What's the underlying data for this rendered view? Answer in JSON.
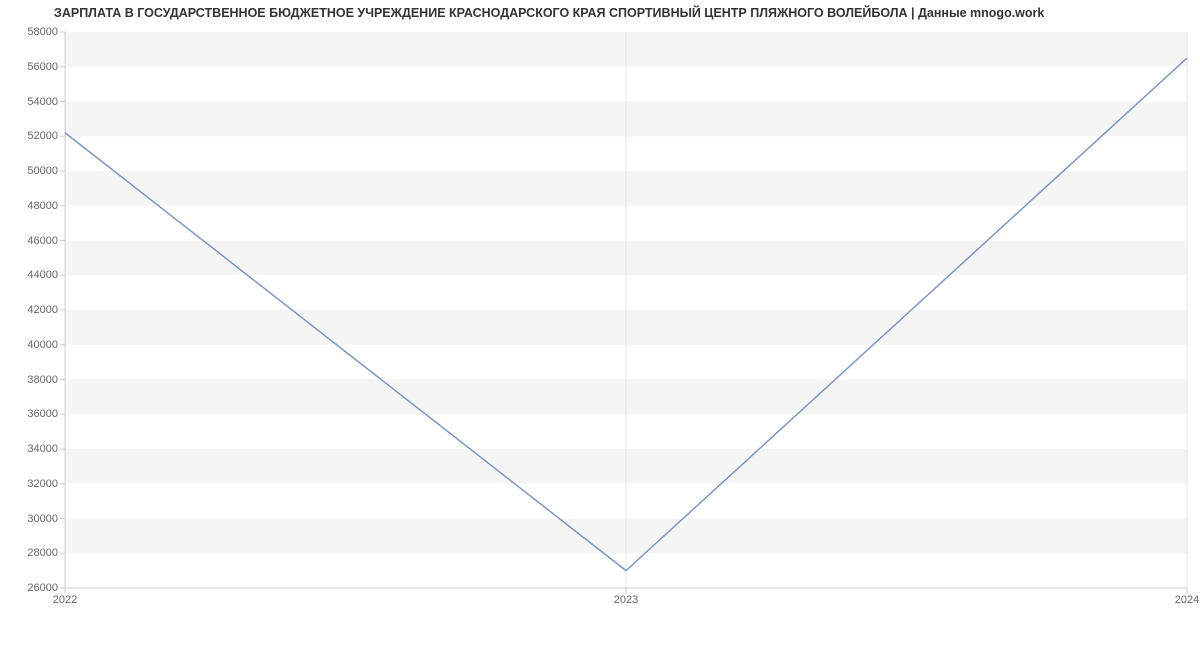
{
  "chart_data": {
    "type": "line",
    "title": "ЗАРПЛАТА В ГОСУДАРСТВЕННОЕ БЮДЖЕТНОЕ УЧРЕЖДЕНИЕ КРАСНОДАРСКОГО КРАЯ СПОРТИВНЫЙ ЦЕНТР ПЛЯЖНОГО ВОЛЕЙБОЛА | Данные mnogo.work",
    "x": [
      "2022",
      "2023",
      "2024"
    ],
    "values": [
      52200,
      27000,
      56500
    ],
    "xlabel": "",
    "ylabel": "",
    "ylim": [
      26000,
      58000
    ],
    "y_ticks": [
      26000,
      28000,
      30000,
      32000,
      34000,
      36000,
      38000,
      40000,
      42000,
      44000,
      46000,
      48000,
      50000,
      52000,
      54000,
      56000,
      58000
    ],
    "colors": {
      "line": "#7B97C6",
      "band": "#f5f5f5",
      "axis": "#cccccc"
    }
  }
}
